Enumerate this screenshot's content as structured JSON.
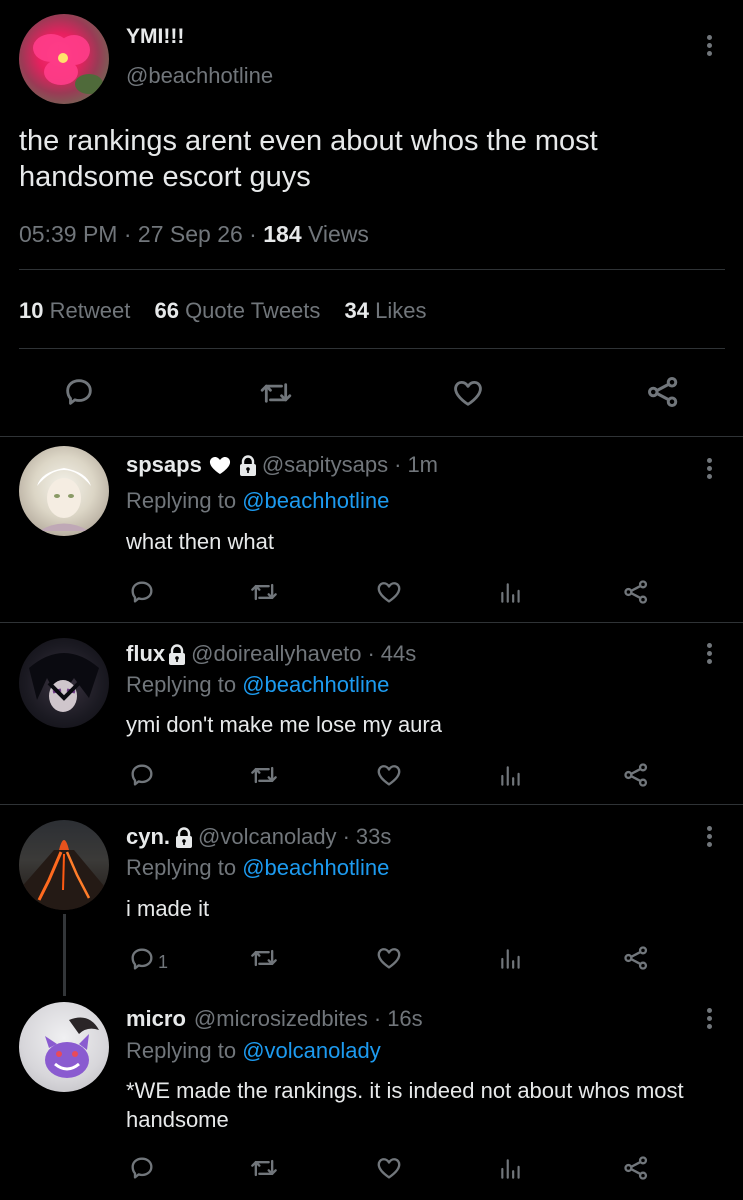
{
  "main_tweet": {
    "display_name": "YMI!!!",
    "handle": "@beachhotline",
    "text": "the rankings arent even about whos the most handsome escort guys",
    "time": "05:39 PM",
    "date": "27 Sep 26",
    "views_count": "184",
    "views_label": "Views",
    "separator": "·",
    "retweets_count": "10",
    "retweets_label": "Retweet",
    "quotes_count": "66",
    "quotes_label": "Quote Tweets",
    "likes_count": "34",
    "likes_label": "Likes"
  },
  "replying_to_label": "Replying to",
  "replies": [
    {
      "name": "spsaps",
      "handle": "@sapitysaps",
      "time": "1m",
      "reply_to": "@beachhotline",
      "text": "what then what",
      "reply_count": "",
      "has_heart": true
    },
    {
      "name": "flux",
      "handle": "@doireallyhaveto",
      "time": "44s",
      "reply_to": "@beachhotline",
      "text": "ymi don't make me lose my aura",
      "reply_count": "",
      "has_heart": false
    },
    {
      "name": "cyn.",
      "handle": "@volcanolady",
      "time": "33s",
      "reply_to": "@beachhotline",
      "text": "i made it",
      "reply_count": "1",
      "has_heart": false
    },
    {
      "name": "micro",
      "handle": "@microsizedbites",
      "time": "16s",
      "reply_to": "@volcanolady",
      "text": "*WE made the rankings. it is indeed not about whos most handsome",
      "reply_count": "",
      "has_heart": false
    }
  ],
  "colors": {
    "background": "#000000",
    "text": "#e7e9ea",
    "muted": "#71767b",
    "link": "#1d9bf0",
    "divider": "#2f3336"
  }
}
